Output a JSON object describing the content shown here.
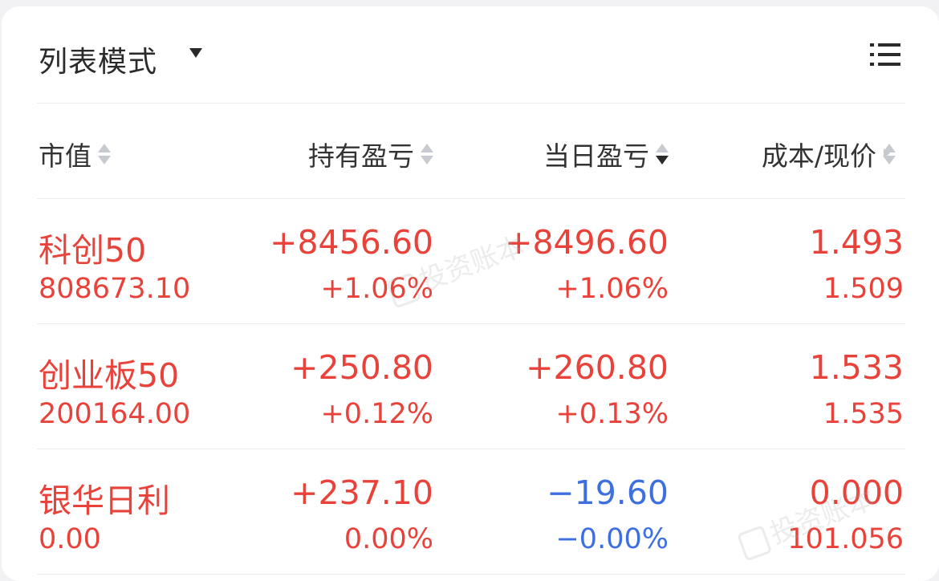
{
  "header": {
    "mode_title": "列表模式"
  },
  "columns": [
    {
      "label": "市值",
      "sort": "none"
    },
    {
      "label": "持有盈亏",
      "sort": "none"
    },
    {
      "label": "当日盈亏",
      "sort": "desc"
    },
    {
      "label": "成本/现价",
      "sort": "none"
    }
  ],
  "rows": [
    {
      "name": "科创50",
      "market_value": "808673.10",
      "hold_pnl": "+8456.60",
      "hold_pct": "+1.06%",
      "day_pnl": "+8496.60",
      "day_pct": "+1.06%",
      "cost": "1.493",
      "price": "1.509"
    },
    {
      "name": "创业板50",
      "market_value": "200164.00",
      "hold_pnl": "+250.80",
      "hold_pct": "+0.12%",
      "day_pnl": "+260.80",
      "day_pct": "+0.13%",
      "cost": "1.533",
      "price": "1.535"
    },
    {
      "name": "银华日利",
      "market_value": "0.00",
      "hold_pnl": "+237.10",
      "hold_pct": "0.00%",
      "day_pnl": "−19.60",
      "day_pct": "−0.00%",
      "cost": "0.000",
      "price": "101.056"
    }
  ],
  "watermark": "投资账本",
  "colors": {
    "up": "#e8423a",
    "down": "#3d6fe0"
  }
}
